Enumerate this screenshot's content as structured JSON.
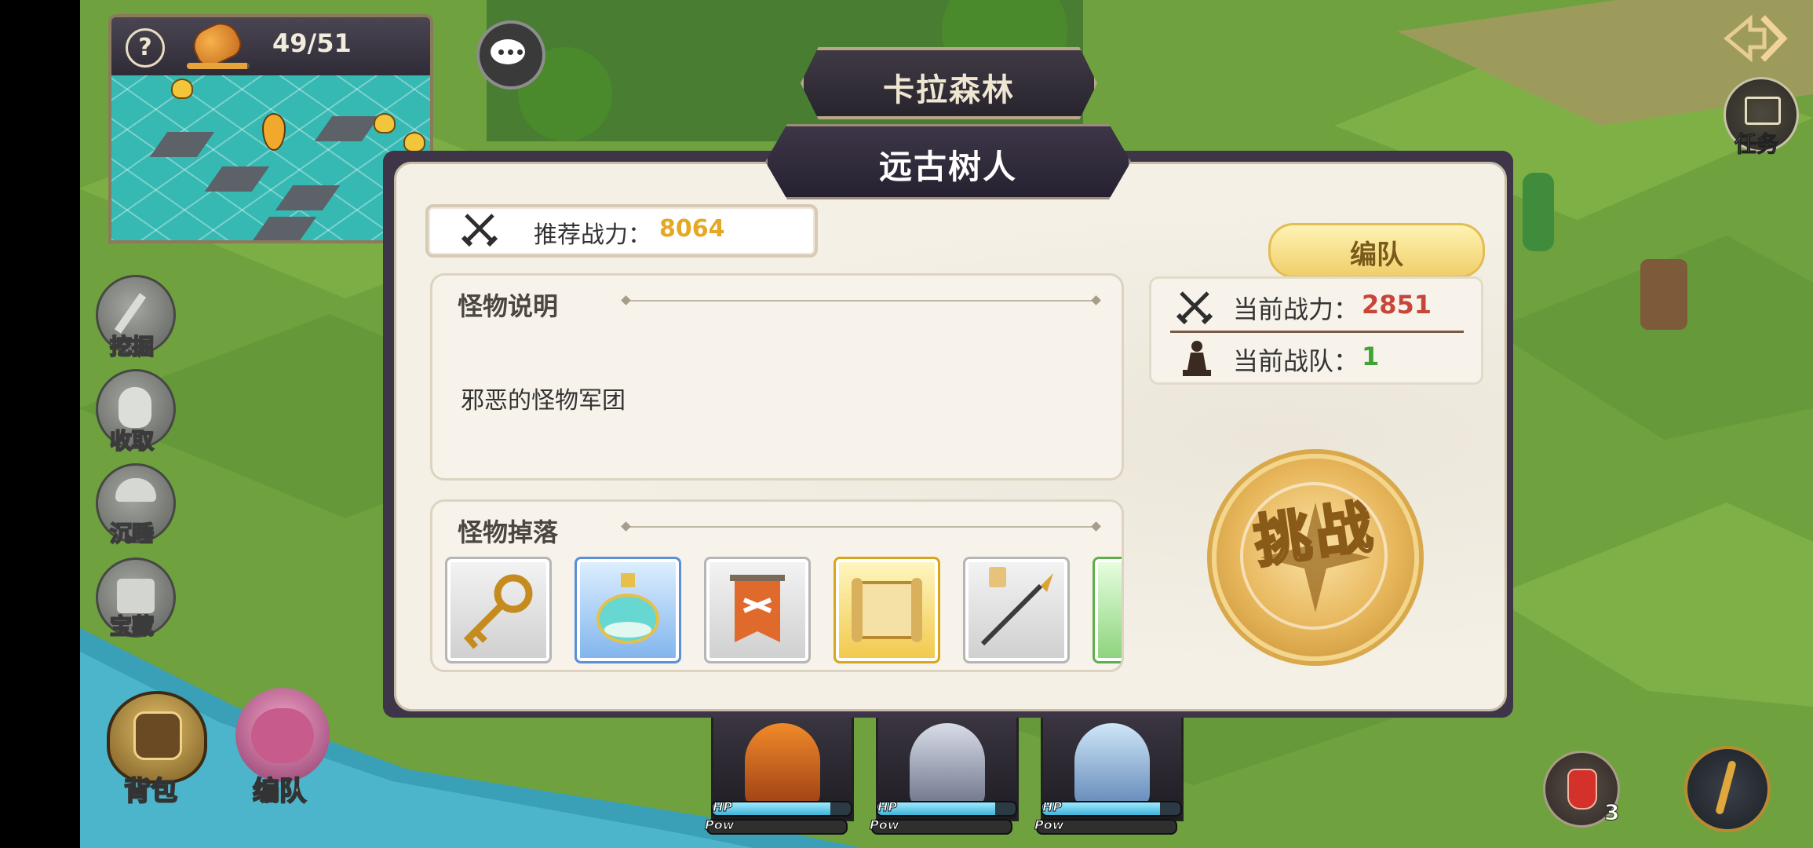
{
  "hud": {
    "stamina": "49/51",
    "stamina_fill": 0.96,
    "help_label": "?",
    "location": "卡拉森林",
    "task_label": "任务",
    "side_buttons": [
      {
        "label": "挖掘",
        "icon": "shovel-icon"
      },
      {
        "label": "收取",
        "icon": "hand-icon"
      },
      {
        "label": "沉睡",
        "icon": "mushroom-icon"
      },
      {
        "label": "宝藏",
        "icon": "treasure-map-icon"
      }
    ],
    "bag_label": "背包",
    "team_label": "编队",
    "potion_count": "3"
  },
  "heroes": [
    {
      "hp_label": "HP",
      "pow_label": "Pow",
      "hp": 0.85
    },
    {
      "hp_label": "HP",
      "pow_label": "Pow",
      "hp": 0.85
    },
    {
      "hp_label": "HP",
      "pow_label": "Pow",
      "hp": 0.85
    }
  ],
  "modal": {
    "title": "远古树人",
    "recommended_label": "推荐战力：",
    "recommended_value": "8064",
    "desc_title": "怪物说明",
    "desc_text": "邪恶的怪物军团",
    "drop_title": "怪物掉落",
    "drops": [
      {
        "icon": "key-icon",
        "rarity": "gray"
      },
      {
        "icon": "potion-flask-icon",
        "rarity": "blue"
      },
      {
        "icon": "banner-icon",
        "rarity": "gray"
      },
      {
        "icon": "scroll-icon",
        "rarity": "gold"
      },
      {
        "icon": "spear-icon",
        "rarity": "gray"
      },
      {
        "icon": "partial-item-icon",
        "rarity": "green"
      }
    ],
    "team_edit_label": "编队",
    "current_power_label": "当前战力：",
    "current_power_value": "2851",
    "current_squad_label": "当前战队：",
    "current_squad_value": "1",
    "challenge_label": "挑战"
  },
  "colors": {
    "recommended": "#e4a823",
    "current_power": "#c8453a",
    "current_squad": "#3fa435"
  }
}
